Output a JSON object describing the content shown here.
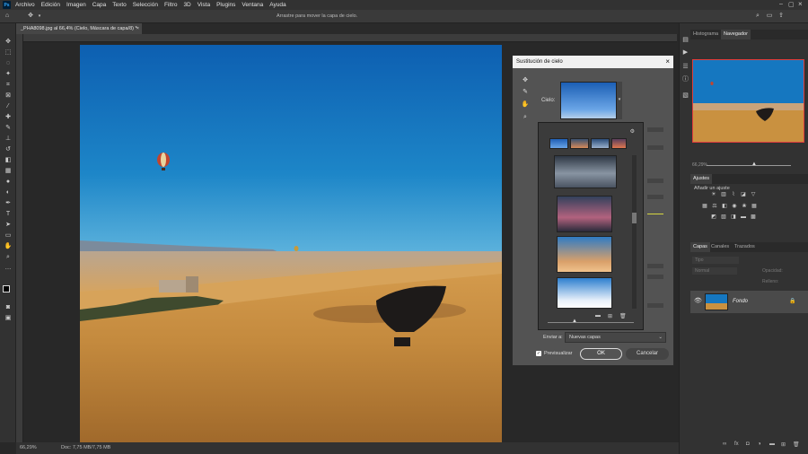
{
  "app": {
    "logo": "Ps"
  },
  "menu": [
    "Archivo",
    "Edición",
    "Imagen",
    "Capa",
    "Texto",
    "Selección",
    "Filtro",
    "3D",
    "Vista",
    "Plugins",
    "Ventana",
    "Ayuda"
  ],
  "options_bar": {
    "hint": "Arrastre para mover la capa de cielo."
  },
  "document": {
    "tab_title": "_PHA8098.jpg al 66,4% (Cielo, Máscara de capa/8) *"
  },
  "status": {
    "zoom": "66,29%",
    "doc_info": "Doc: 7,75 MB/7,75 MB"
  },
  "dialog": {
    "title": "Sustitución de cielo",
    "sky_label": "Cielo:",
    "send_label": "Enviar a:",
    "send_value": "Nuevas capas",
    "preview_label": "Previsualizar",
    "ok": "OK",
    "cancel": "Cancelar"
  },
  "panels": {
    "top_tabs": [
      "Histograma",
      "Navegador"
    ],
    "navigator_zoom": "66,29%",
    "adjust_tab": "Ajustes",
    "adjust_subtitle": "Añadir un ajuste",
    "layers_tabs": [
      "Capas",
      "Canales",
      "Trazados"
    ],
    "layers_filter": "Tipo",
    "blend_mode": "Normal",
    "opacity_label": "Opacidad:",
    "fill_label": "Relleno:",
    "layer_name": "Fondo"
  },
  "colors": {
    "accent": "#31a8ff",
    "nav_box": "#e23c3c",
    "sky_top": "#1c6fb8",
    "field": "#c48a3e"
  }
}
